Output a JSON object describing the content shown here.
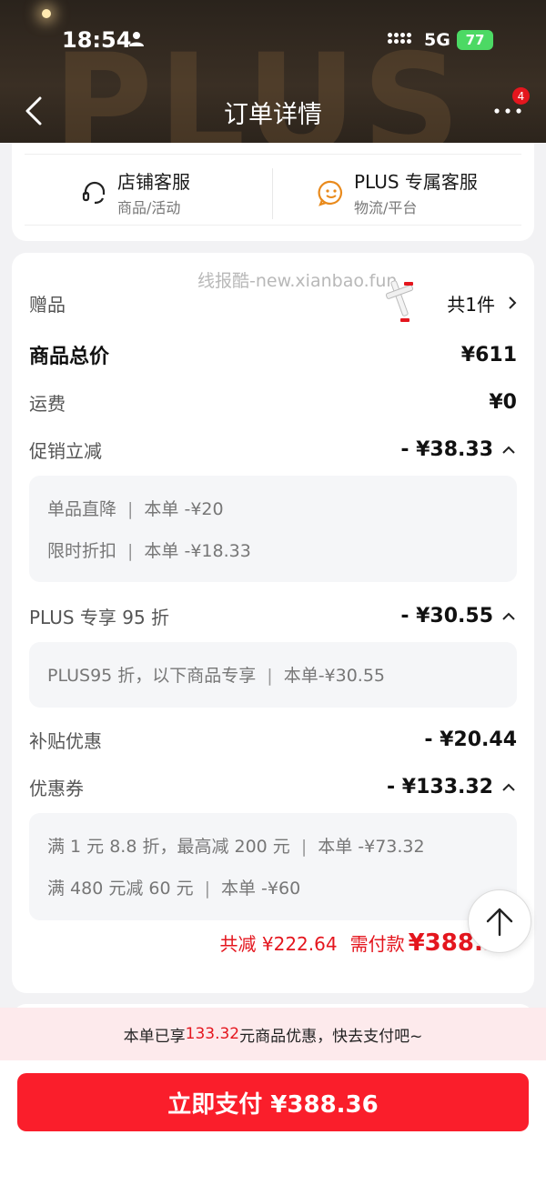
{
  "status_bar": {
    "time": "18:54",
    "network": "5G",
    "battery": "77"
  },
  "header": {
    "title": "订单详情",
    "bg_text": "PLUS",
    "badge_count": "4"
  },
  "service": {
    "store": {
      "title": "店铺客服",
      "subtitle": "商品/活动"
    },
    "plus": {
      "title": "PLUS 专属客服",
      "subtitle": "物流/平台"
    }
  },
  "watermark": "线报酷-new.xianbao.fun",
  "gift": {
    "label": "赠品",
    "count": "共1件"
  },
  "rows": {
    "total": {
      "label": "商品总价",
      "value": "¥611"
    },
    "shipping": {
      "label": "运费",
      "value": "¥0"
    },
    "promo": {
      "label": "促销立减",
      "value": "- ¥38.33"
    },
    "plus": {
      "label": "PLUS 专享 95 折",
      "value": "- ¥30.55"
    },
    "subsidy": {
      "label": "补贴优惠",
      "value": "- ¥20.44"
    },
    "coupon": {
      "label": "优惠券",
      "value": "- ¥133.32"
    }
  },
  "promo_details": [
    {
      "name": "单品直降",
      "amount": "本单 -¥20"
    },
    {
      "name": "限时折扣",
      "amount": "本单 -¥18.33"
    }
  ],
  "plus_details": [
    {
      "name": "PLUS95 折，以下商品专享",
      "amount": "本单-¥30.55"
    }
  ],
  "coupon_details": [
    {
      "name": "满 1 元 8.8 折，最高减 200 元",
      "amount": "本单 -¥73.32"
    },
    {
      "name": "满 480 元减 60 元",
      "amount": "本单 -¥60"
    }
  ],
  "totals": {
    "save": "共减 ¥222.64",
    "pay_label": "需付款",
    "pay_value": "¥388.36"
  },
  "promo_bar": {
    "prefix": "本单已享",
    "amount": "133.32",
    "suffix": "元商品优惠，快去支付吧~"
  },
  "pay_button": "立即支付 ¥388.36",
  "colors": {
    "accent": "#e4161e",
    "button": "#fa1e2b",
    "header_bg": "#2a231c"
  }
}
